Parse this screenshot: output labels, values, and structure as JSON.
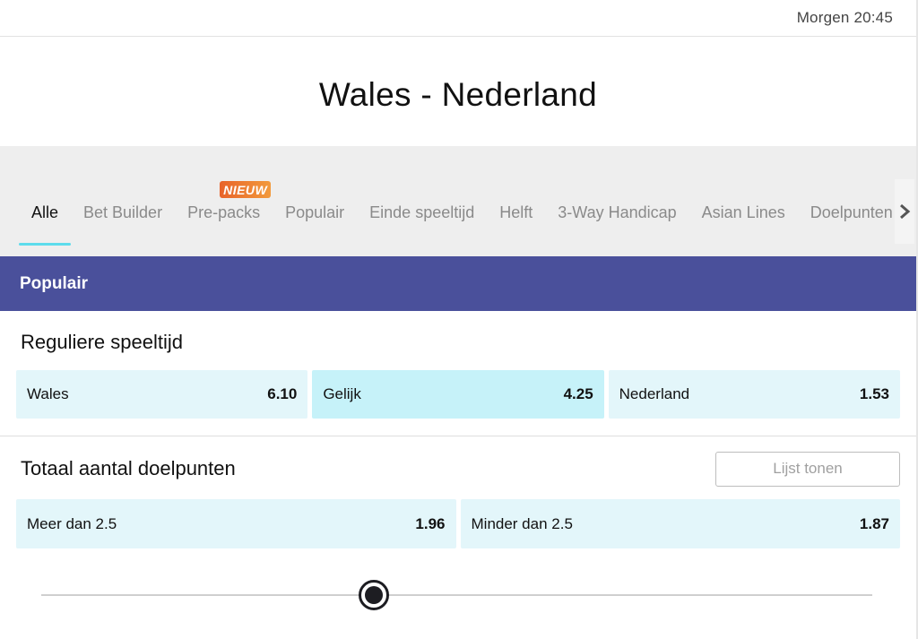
{
  "header": {
    "time": "Morgen 20:45",
    "match_title": "Wales - Nederland"
  },
  "tabs": [
    {
      "label": "Alle",
      "active": true
    },
    {
      "label": "Bet Builder"
    },
    {
      "label": "Pre-packs",
      "badge": "NIEUW"
    },
    {
      "label": "Populair"
    },
    {
      "label": "Einde speeltijd"
    },
    {
      "label": "Helft"
    },
    {
      "label": "3-Way Handicap"
    },
    {
      "label": "Asian Lines"
    },
    {
      "label": "Doelpunten"
    }
  ],
  "tab_scroll_icon": "chevron-right-icon",
  "section": {
    "title": "Populair",
    "color": "#4a509b"
  },
  "markets": [
    {
      "title": "Reguliere speeltijd",
      "outcomes": [
        {
          "label": "Wales",
          "price": "6.10"
        },
        {
          "label": "Gelijk",
          "price": "4.25",
          "highlighted": true
        },
        {
          "label": "Nederland",
          "price": "1.53"
        }
      ]
    },
    {
      "title": "Totaal aantal doelpunten",
      "action_label": "Lijst tonen",
      "outcomes": [
        {
          "label": "Meer dan 2.5",
          "price": "1.96"
        },
        {
          "label": "Minder dan 2.5",
          "price": "1.87"
        }
      ]
    }
  ],
  "slider": {
    "value": 0.4
  },
  "colors": {
    "accent_underline": "#5ddcec",
    "odd_bg": "#e3f6fa",
    "odd_bg_highlight": "#c6f2f9",
    "badge": "#ec7430"
  }
}
